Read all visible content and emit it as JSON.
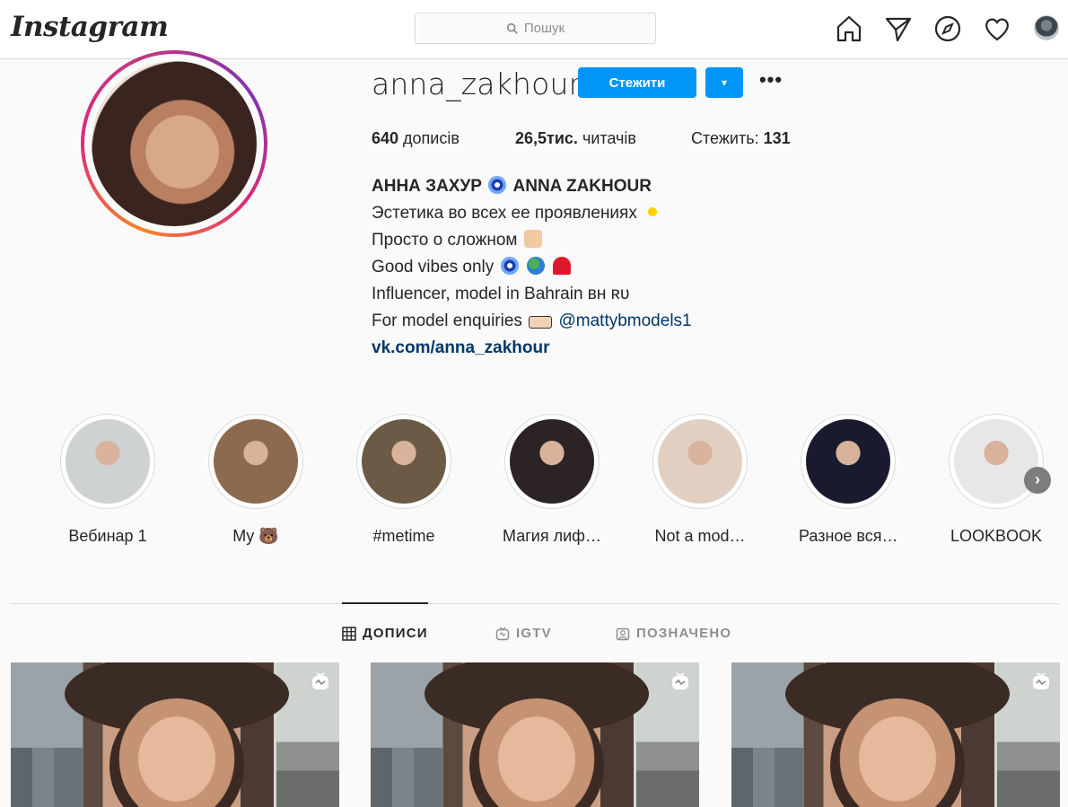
{
  "app": {
    "logo": "Instagram"
  },
  "search": {
    "placeholder": "Пошук"
  },
  "profile": {
    "username": "anna_zakhour",
    "follow_label": "Стежити",
    "dropdown_label": "▾",
    "more_label": "•••",
    "stats": {
      "posts_count": "640",
      "posts_label": " дописів",
      "followers_count": "26,5тис.",
      "followers_label": " читачів",
      "following_label": "Стежить: ",
      "following_count": "131"
    },
    "bio": {
      "name": "АННА ЗАХУР",
      "name_en": "ANNA ZAKHOUR",
      "line1": "Эстетика во всех ее проявлениях",
      "line2": "Просто о сложном",
      "line3": "Good vibes only",
      "line4": "Influencer, model in Bahrain ʙʜ ʀᴜ",
      "line5": "For model enquiries",
      "mention": "@mattybmodels1",
      "link": "vk.com/anna_zakhour"
    }
  },
  "highlights": [
    {
      "label": "Вебинар 1",
      "color": "#cfd2d3"
    },
    {
      "label": "My 🐻",
      "color": "#8b6a4f"
    },
    {
      "label": "#metime",
      "color": "#6b5a45"
    },
    {
      "label": "Магия лиф…",
      "color": "#2b2324"
    },
    {
      "label": "Not a mod…",
      "color": "#e1cfc2"
    },
    {
      "label": "Разное вся…",
      "color": "#1a1a2e"
    },
    {
      "label": "LOOKBOOK",
      "color": "#e7e7e7"
    }
  ],
  "tabs": [
    {
      "label": "ДОПИСИ",
      "icon": "grid-icon"
    },
    {
      "label": "IGTV",
      "icon": "igtv-icon"
    },
    {
      "label": "ПОЗНАЧЕНО",
      "icon": "tagged-icon"
    }
  ],
  "colors": {
    "accent": "#0095f6",
    "link": "#00376b",
    "text": "#262626",
    "muted": "#8e8e8e"
  }
}
